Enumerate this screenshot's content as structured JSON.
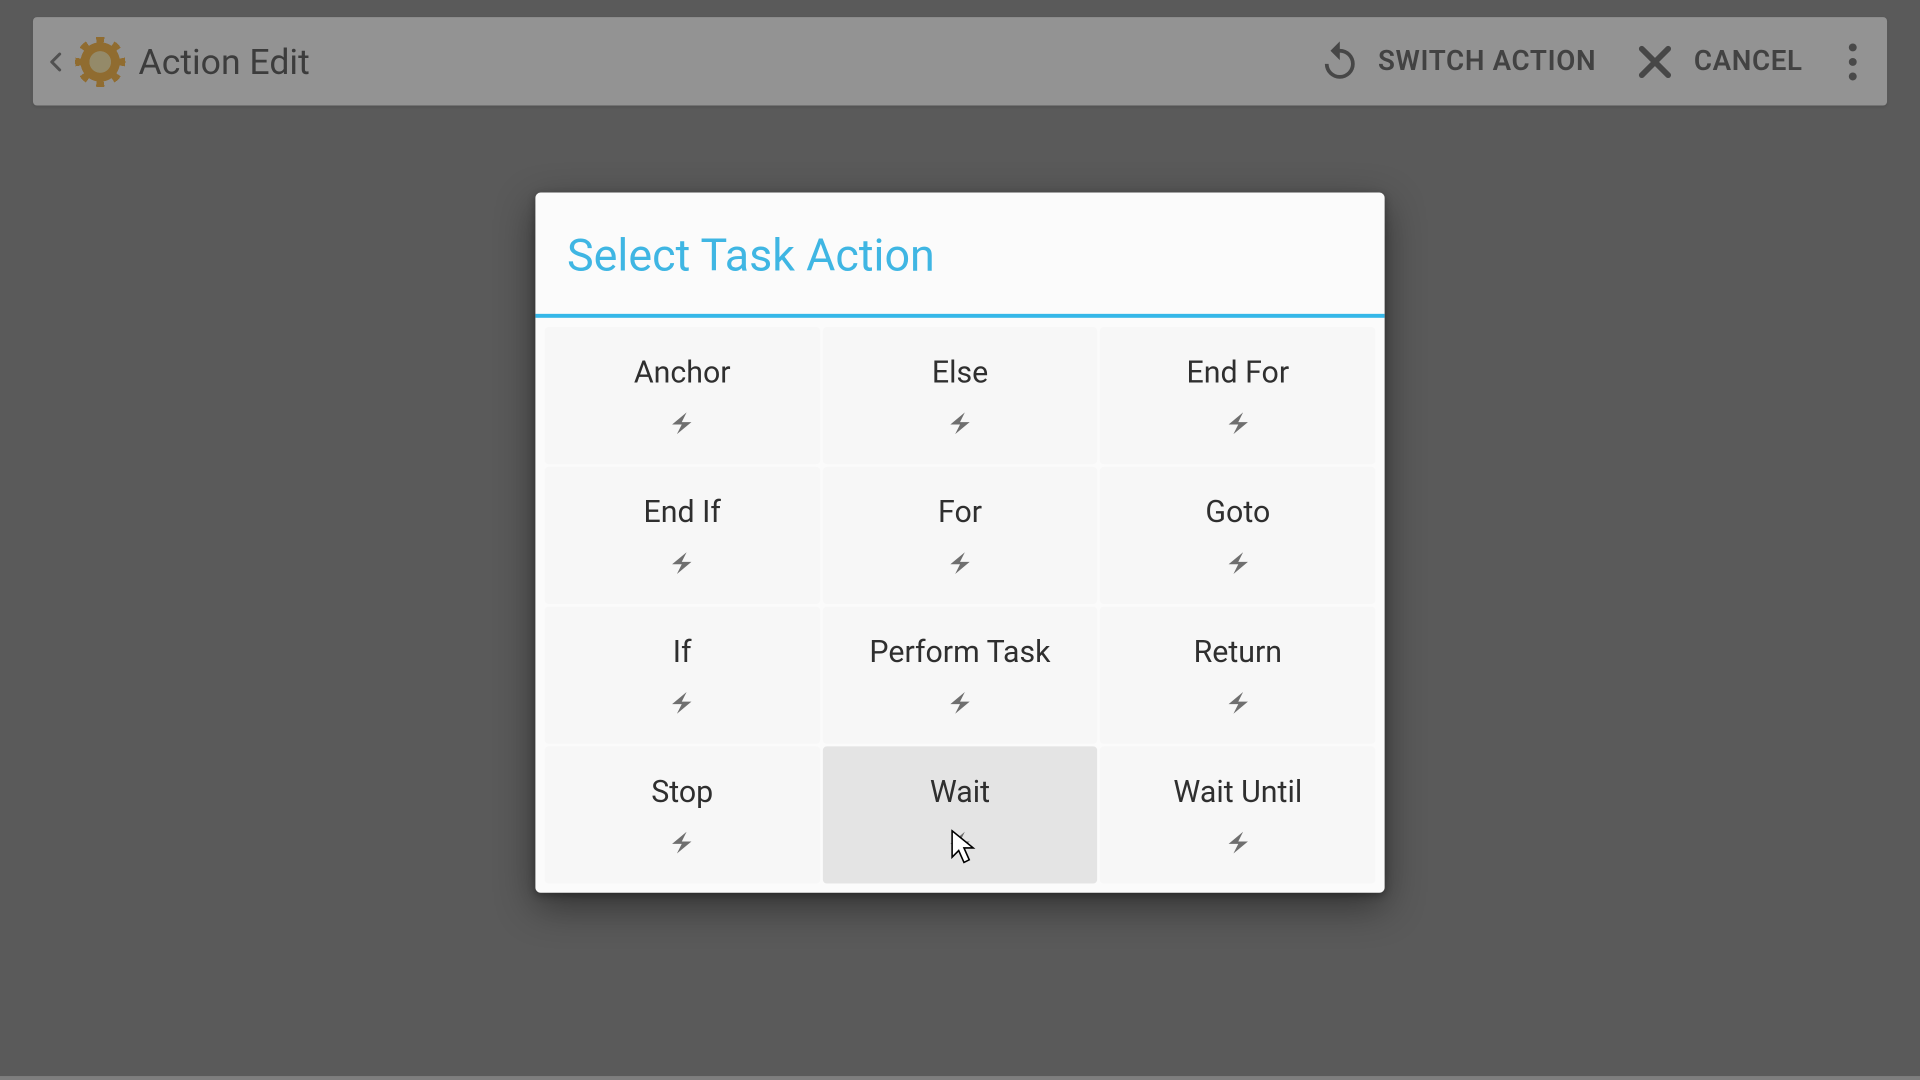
{
  "header": {
    "title": "Action Edit",
    "switch_label": "SWITCH ACTION",
    "cancel_label": "CANCEL"
  },
  "dialog": {
    "title": "Select Task Action",
    "actions": [
      {
        "label": "Anchor"
      },
      {
        "label": "Else"
      },
      {
        "label": "End For"
      },
      {
        "label": "End If"
      },
      {
        "label": "For"
      },
      {
        "label": "Goto"
      },
      {
        "label": "If"
      },
      {
        "label": "Perform Task"
      },
      {
        "label": "Return"
      },
      {
        "label": "Stop"
      },
      {
        "label": "Wait"
      },
      {
        "label": "Wait Until"
      }
    ],
    "hovered_index": 10
  }
}
